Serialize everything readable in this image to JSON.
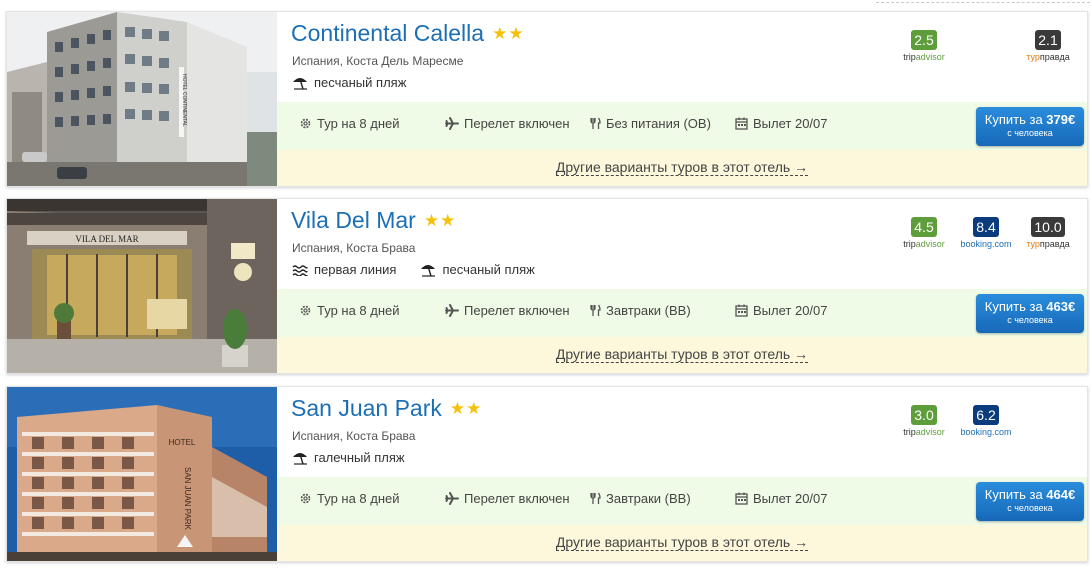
{
  "common": {
    "tour": "Тур на 8 дней",
    "flight": "Перелет включен",
    "departure": "Вылет 20/07",
    "per_person": "с человека",
    "more_link": "Другие варианты туров в этот отель →"
  },
  "hotels": [
    {
      "name": "Continental Calella",
      "stars": 2,
      "location": "Испания, Коста Дель Маресме",
      "features": [
        "песчаный пляж"
      ],
      "meal": "Без питания (OB)",
      "buy_prefix": "Купить за ",
      "price": "379€",
      "ratings": {
        "tripadvisor": "2.5",
        "turpravda": "2.1"
      }
    },
    {
      "name": "Vila Del Mar",
      "stars": 2,
      "location": "Испания, Коста Брава",
      "features": [
        "первая линия",
        "песчаный пляж"
      ],
      "meal": "Завтраки (BB)",
      "buy_prefix": "Купить за ",
      "price": "463€",
      "ratings": {
        "tripadvisor": "4.5",
        "booking": "8.4",
        "turpravda": "10.0"
      }
    },
    {
      "name": "San Juan Park",
      "stars": 2,
      "location": "Испания, Коста Брава",
      "features": [
        "галечный пляж"
      ],
      "meal": "Завтраки (BB)",
      "buy_prefix": "Купить за ",
      "price": "464€",
      "ratings": {
        "tripadvisor": "3.0",
        "booking": "6.2"
      }
    }
  ],
  "rating_sources": {
    "tripadvisor_a": "trip",
    "tripadvisor_b": "advisor",
    "booking": "booking.com",
    "turpravda_a": "тур",
    "turpravda_b": "правда"
  },
  "photo_signs": [
    "HOTEL CONTINENTAL",
    "VILA DEL MAR",
    "HOTEL",
    "SAN JUAN PARK"
  ],
  "colors": {
    "link": "#1d6fb5",
    "tripadvisor": "#5d9e3b",
    "booking": "#0a3b7d",
    "turpravda": "#3a3a3a",
    "offer_bg": "#effbe7",
    "more_bg": "#fdf8dc",
    "button": "#1d7bcb"
  }
}
